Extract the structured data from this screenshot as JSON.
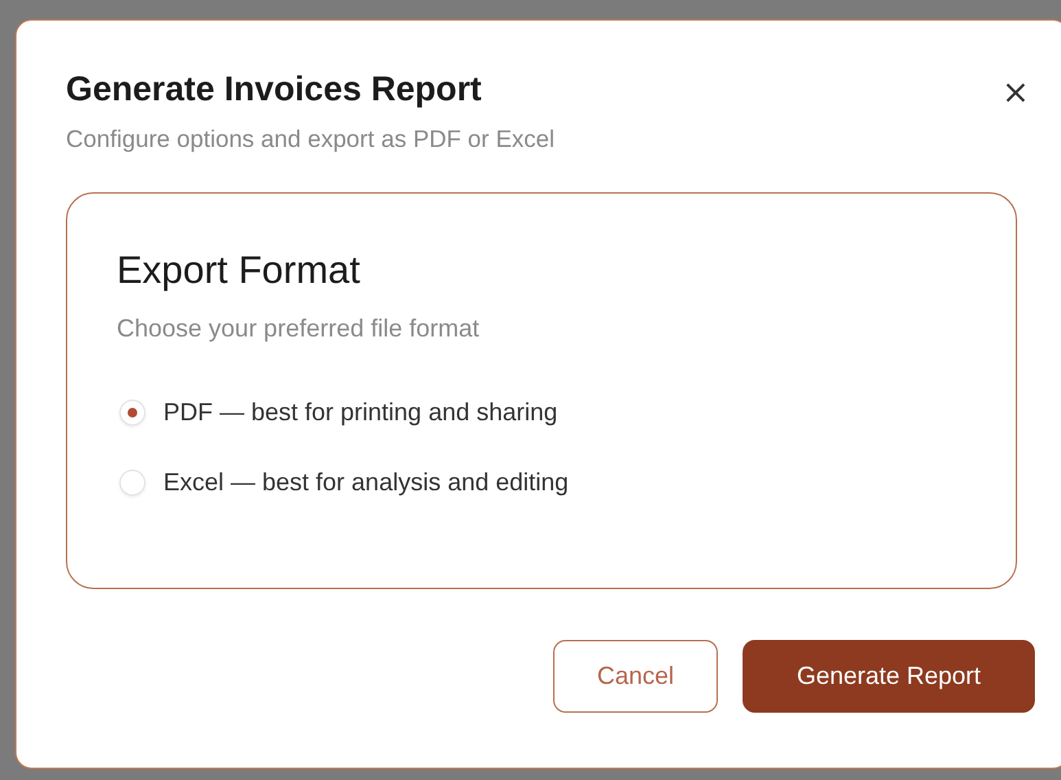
{
  "dialog": {
    "title": "Generate Invoices Report",
    "subtitle": "Configure options and export as PDF or Excel",
    "close": "×"
  },
  "section": {
    "title": "Export Format",
    "description": "Choose your preferred file format",
    "options": [
      {
        "label": "PDF — best for printing and sharing",
        "selected": true
      },
      {
        "label": "Excel — best for analysis and editing",
        "selected": false
      }
    ]
  },
  "buttons": [
    {
      "label": "Cancel",
      "kind": "secondary"
    },
    {
      "label": "Generate Report",
      "kind": "primary"
    }
  ]
}
